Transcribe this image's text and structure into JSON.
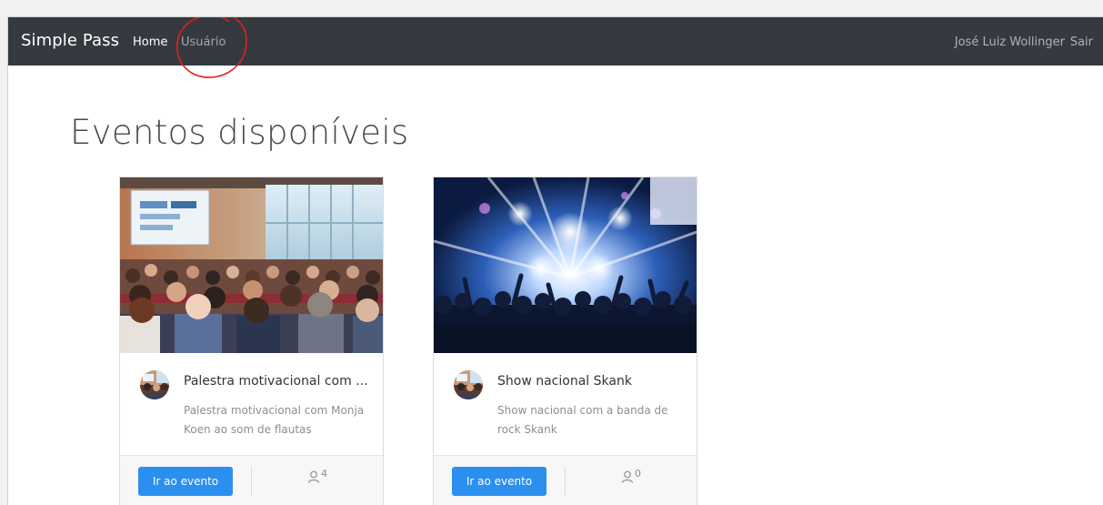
{
  "navbar": {
    "brand": "Simple Pass",
    "links": [
      {
        "label": "Home",
        "active": true
      },
      {
        "label": "Usuário",
        "active": false
      }
    ],
    "user_name": "José Luiz Wollinger",
    "logout_label": "Sair",
    "background": "#343a40"
  },
  "main": {
    "title": "Eventos disponíveis"
  },
  "events": [
    {
      "title": "Palestra motivacional com ...",
      "description": "Palestra motivacional com Monja Koen ao som de flautas",
      "button_label": "Ir ao evento",
      "attendees": "4",
      "image_icon": "audience-photo",
      "avatar_icon": "event-avatar"
    },
    {
      "title": "Show nacional Skank",
      "description": "Show nacional com a banda de rock Skank",
      "button_label": "Ir ao evento",
      "attendees": "0",
      "image_icon": "concert-photo",
      "avatar_icon": "event-avatar"
    }
  ],
  "colors": {
    "primary_button": "#2b8ff0",
    "annotation": "#e02020"
  }
}
